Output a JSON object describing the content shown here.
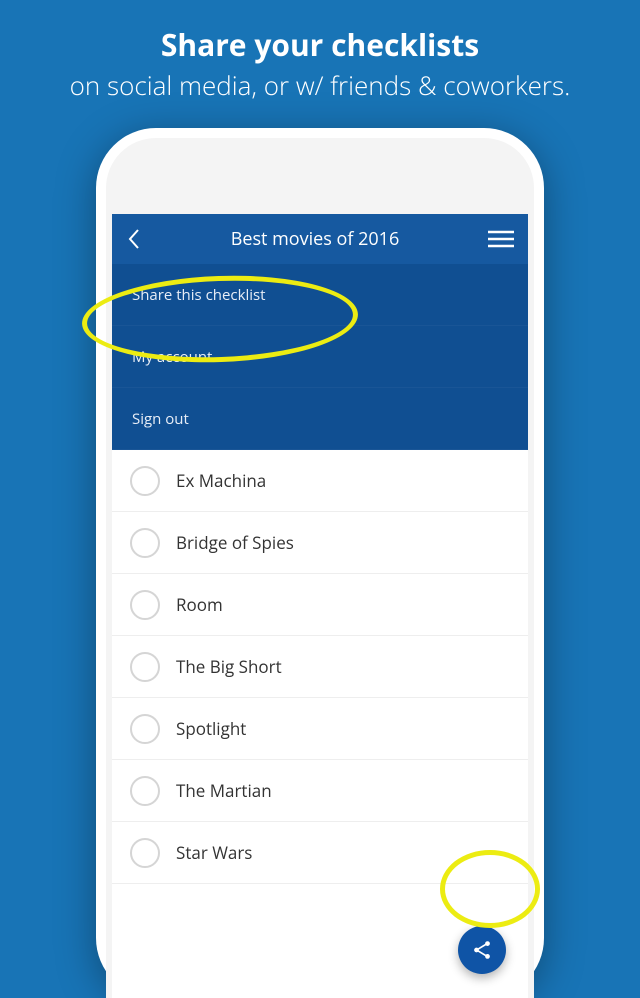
{
  "promo": {
    "line1": "Share your checklists",
    "line2": "on social media, or w/ friends & coworkers."
  },
  "navbar": {
    "title": "Best movies of 2016"
  },
  "dropdown": {
    "items": [
      {
        "label": "Share this checklist"
      },
      {
        "label": "My account"
      },
      {
        "label": "Sign out"
      }
    ]
  },
  "checklist": {
    "items": [
      {
        "label": "Ex Machina"
      },
      {
        "label": "Bridge of Spies"
      },
      {
        "label": "Room"
      },
      {
        "label": "The Big Short"
      },
      {
        "label": "Spotlight"
      },
      {
        "label": "The Martian"
      },
      {
        "label": "Star Wars"
      }
    ]
  }
}
